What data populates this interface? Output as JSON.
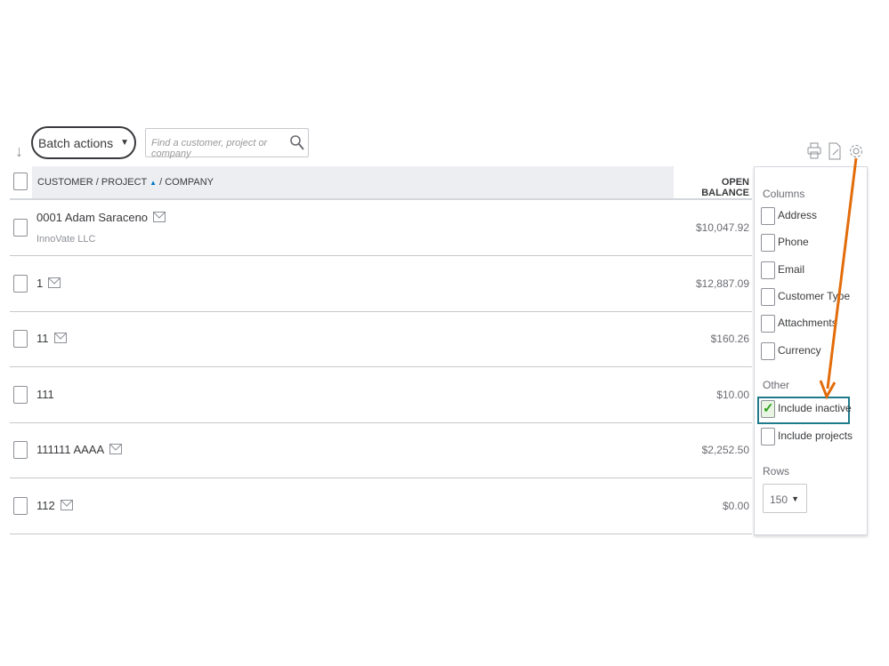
{
  "toolbar": {
    "batch_actions": "Batch actions",
    "search_placeholder": "Find a customer, project or company"
  },
  "table": {
    "col_customer": "CUSTOMER / PROJECT",
    "col_company": "/ COMPANY",
    "col_balance": "OPEN BALANCE",
    "rows": [
      {
        "name": "0001 Adam Saraceno",
        "company": "InnoVate LLC",
        "balance": "$10,047.92",
        "email": true
      },
      {
        "name": "1",
        "company": "",
        "balance": "$12,887.09",
        "email": true
      },
      {
        "name": "11",
        "company": "",
        "balance": "$160.26",
        "email": true
      },
      {
        "name": "111",
        "company": "",
        "balance": "$10.00",
        "email": false
      },
      {
        "name": "111111 AAAA",
        "company": "",
        "balance": "$2,252.50",
        "email": true
      },
      {
        "name": "112",
        "company": "",
        "balance": "$0.00",
        "email": true
      }
    ]
  },
  "settings": {
    "columns_label": "Columns",
    "columns": [
      {
        "label": "Address",
        "checked": false
      },
      {
        "label": "Phone",
        "checked": false
      },
      {
        "label": "Email",
        "checked": false
      },
      {
        "label": "Customer Type",
        "checked": false
      },
      {
        "label": "Attachments",
        "checked": false
      },
      {
        "label": "Currency",
        "checked": false
      }
    ],
    "other_label": "Other",
    "other": [
      {
        "label": "Include inactive",
        "checked": true
      },
      {
        "label": "Include projects",
        "checked": false
      }
    ],
    "rows_label": "Rows",
    "rows_value": "150"
  },
  "colors": {
    "annotation_arrow": "#e36c0a",
    "highlight_box": "#1f7a8c",
    "check": "#2ca01c"
  }
}
